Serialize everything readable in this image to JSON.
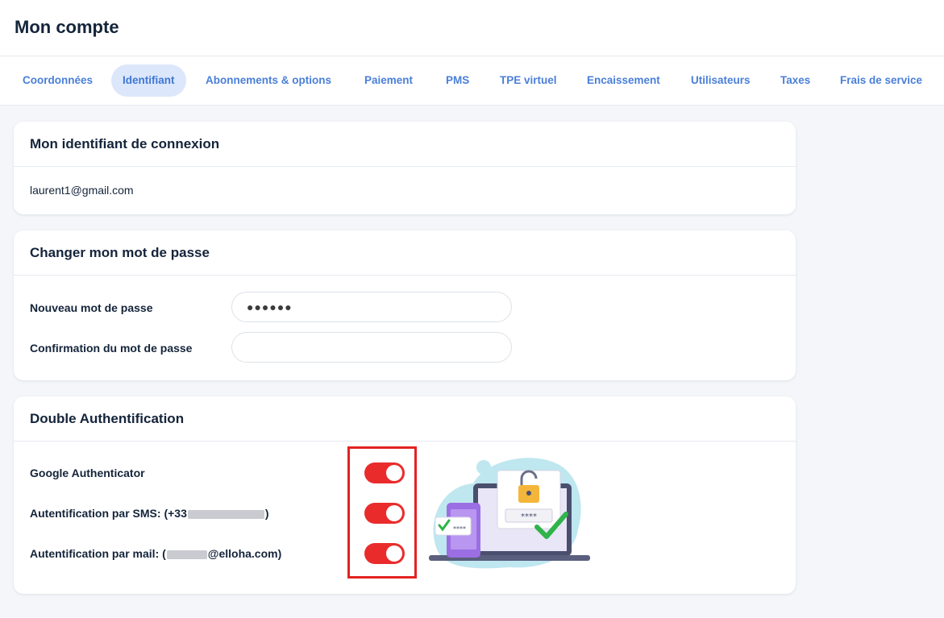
{
  "header": {
    "title": "Mon compte"
  },
  "tabs": [
    {
      "label": "Coordonnées",
      "active": false
    },
    {
      "label": "Identifiant",
      "active": true
    },
    {
      "label": "Abonnements & options",
      "active": false
    },
    {
      "label": "Paiement",
      "active": false
    },
    {
      "label": "PMS",
      "active": false
    },
    {
      "label": "TPE virtuel",
      "active": false
    },
    {
      "label": "Encaissement",
      "active": false
    },
    {
      "label": "Utilisateurs",
      "active": false
    },
    {
      "label": "Taxes",
      "active": false
    },
    {
      "label": "Frais de service",
      "active": false
    }
  ],
  "login_card": {
    "title": "Mon identifiant de connexion",
    "email": "laurent1@gmail.com"
  },
  "password_card": {
    "title": "Changer mon mot de passe",
    "new_password_label": "Nouveau mot de passe",
    "new_password_value": "●●●●●●",
    "confirm_label": "Confirmation du mot de passe",
    "confirm_value": ""
  },
  "twofa_card": {
    "title": "Double Authentification",
    "google_label": "Google Authenticator",
    "sms_label_prefix": "Autentification par SMS: (+33",
    "sms_label_suffix": ")",
    "mail_label_prefix": "Autentification par mail: (",
    "mail_label_suffix": "@elloha.com)",
    "google_enabled": true,
    "sms_enabled": true,
    "mail_enabled": true
  },
  "colors": {
    "accent": "#4a7fd8",
    "active_tab_bg": "#dce7fb",
    "toggle_on": "#ea2b2b",
    "highlight_border": "#e32222"
  }
}
